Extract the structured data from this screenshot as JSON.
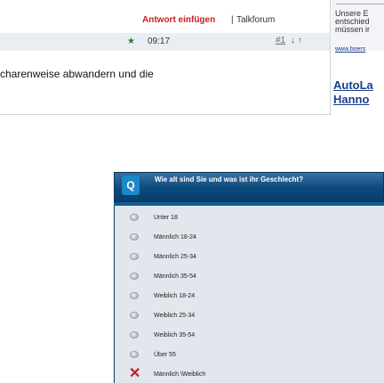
{
  "toolbar": {
    "answer_link": "Antwort einfügen",
    "separator": "|",
    "forum_link": "Talkforum"
  },
  "post": {
    "star_icon": "star-icon",
    "time": "09:17",
    "number": "#1",
    "nav_down": "↓",
    "nav_up": "↑",
    "text": "charenweise abwandern und die"
  },
  "sidebar": {
    "ad_text": "Unsere E\nentschied\nmüssen ir",
    "ad_link": "www.boers",
    "promo_line1": "AutoLa",
    "promo_line2": "Hanno"
  },
  "poll": {
    "badge": "Q",
    "question": "Wie alt sind Sie und was ist ihr Geschlecht?",
    "options": [
      "Unter 18",
      "Männlich 18-24",
      "Männlich 25-34",
      "Männlich 35-54",
      "Weiblich 18-24",
      "Weiblich 25-34",
      "Weiblich 35-54",
      "Über 55",
      "Männlich \\Weiblich"
    ],
    "close_icon": "x-mark-icon"
  }
}
